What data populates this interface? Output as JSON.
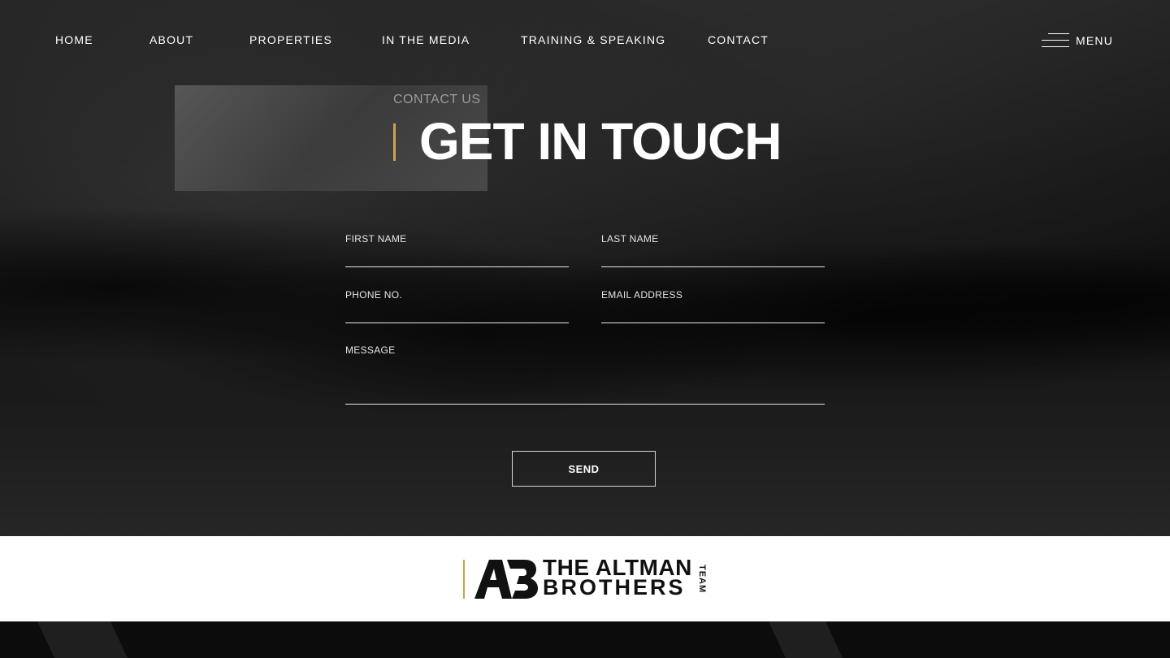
{
  "nav": {
    "items": [
      {
        "label": "HOME"
      },
      {
        "label": "ABOUT"
      },
      {
        "label": "PROPERTIES"
      },
      {
        "label": "IN THE MEDIA"
      },
      {
        "label": "TRAINING & SPEAKING"
      },
      {
        "label": "CONTACT"
      }
    ],
    "menu_label": "MENU",
    "menu_icon": "hamburger-icon"
  },
  "hero": {
    "eyebrow": "CONTACT US",
    "title": "GET IN TOUCH",
    "accent_color": "#c9a44c"
  },
  "form": {
    "first_name_label": "FIRST NAME",
    "last_name_label": "LAST NAME",
    "phone_label": "PHONE NO.",
    "email_label": "EMAIL ADDRESS",
    "message_label": "MESSAGE",
    "send_label": "SEND"
  },
  "logo": {
    "mark": "AB",
    "line1": "THE ALTMAN",
    "line2": "BROTHERS",
    "tag": "TEAM"
  }
}
